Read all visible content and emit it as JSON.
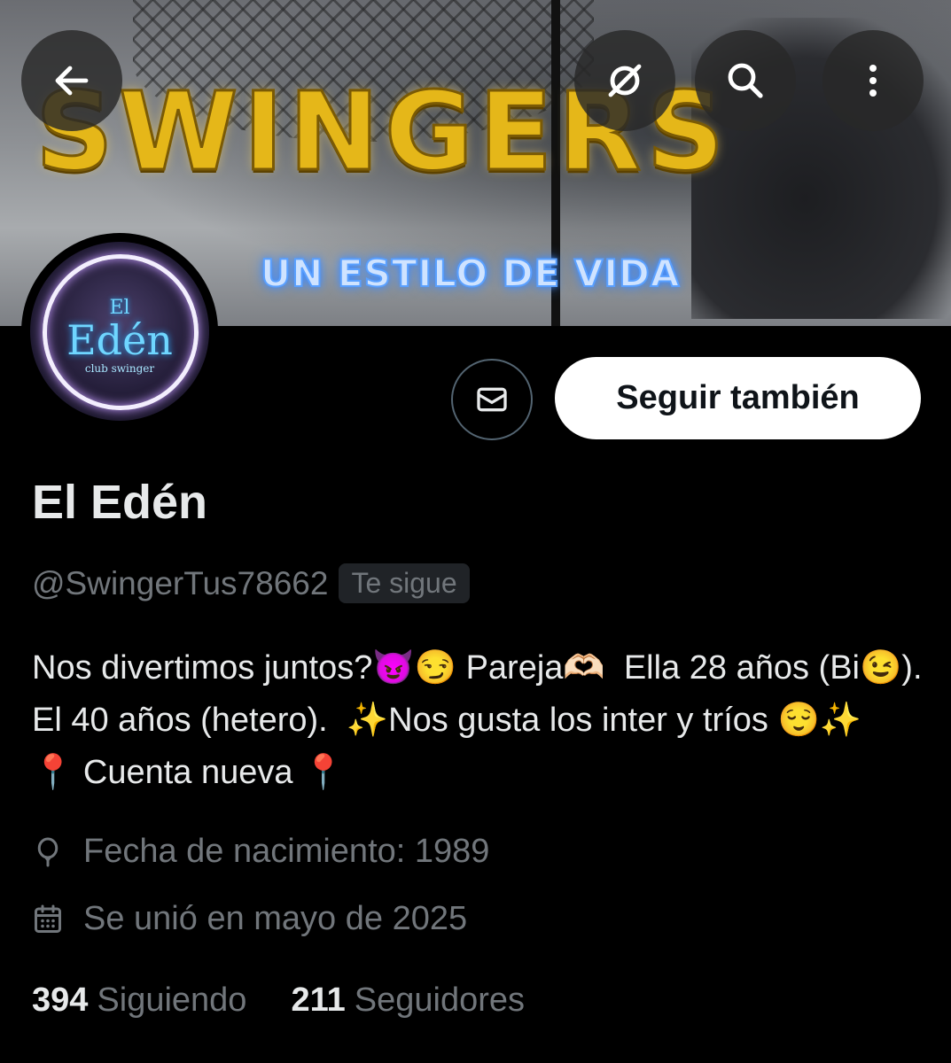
{
  "banner": {
    "title": "SWINGERS",
    "subtitle": "UN ESTILO DE VIDA"
  },
  "header_icons": {
    "back": "arrow-left-icon",
    "mute": "muted-circle-icon",
    "search": "search-icon",
    "more": "more-vertical-icon"
  },
  "avatar": {
    "logo_small": "El",
    "logo": "Edén",
    "logo_tag": "club swinger"
  },
  "actions": {
    "message_icon": "envelope-icon",
    "follow_label": "Seguir también"
  },
  "profile": {
    "name": "El Edén",
    "handle": "@SwingerTus78662",
    "follows_you": "Te sigue",
    "bio": "Nos divertimos juntos?😈😏 Pareja🫶🏻  Ella 28 años (Bi😉).  El 40 años (hetero).  ✨Nos gusta los inter y tríos 😌✨         📍 Cuenta nueva 📍",
    "birth": "Fecha de nacimiento: 1989",
    "joined": "Se unió en mayo de 2025"
  },
  "stats": {
    "following_count": "394",
    "following_label": "Siguiendo",
    "followers_count": "211",
    "followers_label": "Seguidores"
  },
  "colors": {
    "background": "#000000",
    "text_primary": "#e7e9ea",
    "text_secondary": "#71767b",
    "banner_gold": "#e5b719",
    "neon_blue": "#3f8cff"
  }
}
